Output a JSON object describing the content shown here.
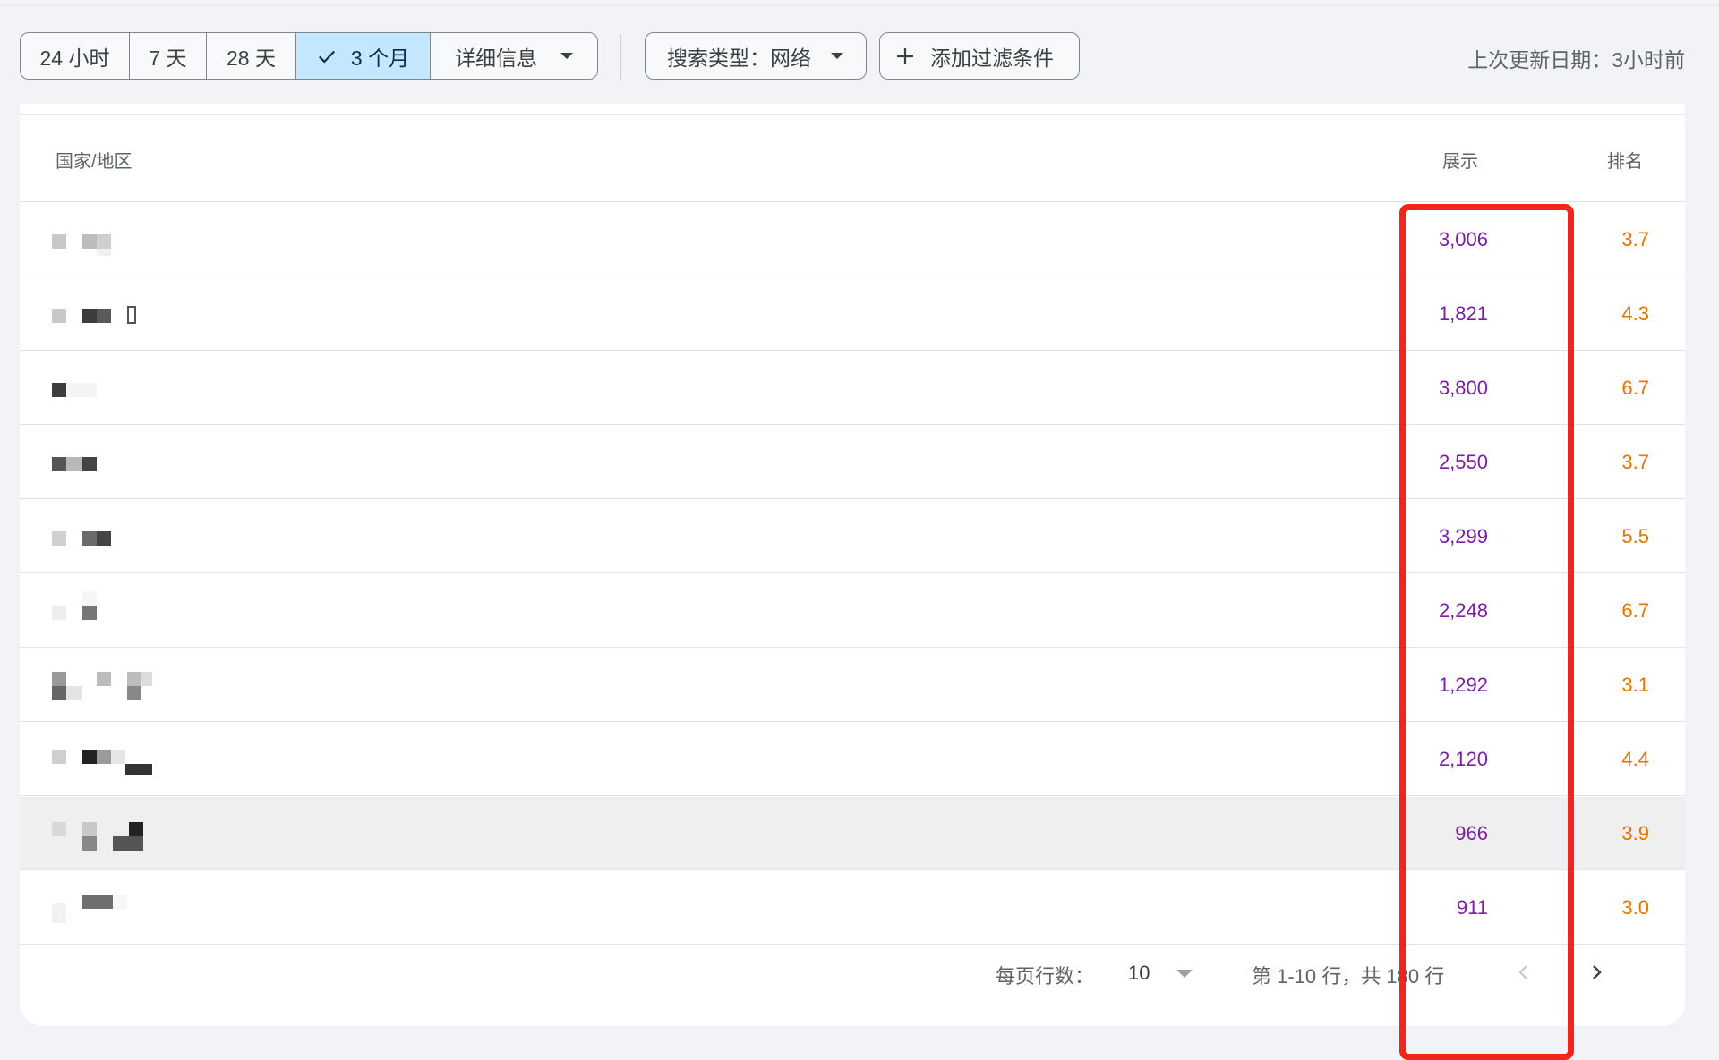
{
  "toolbar": {
    "ranges": [
      {
        "label": "24 小时",
        "active": false
      },
      {
        "label": "7 天",
        "active": false
      },
      {
        "label": "28 天",
        "active": false
      },
      {
        "label": "3 个月",
        "active": true
      }
    ],
    "more_label": "详细信息",
    "search_type_label": "搜索类型：网络",
    "add_filter_label": "添加过滤条件",
    "last_updated": "上次更新日期：3小时前"
  },
  "table": {
    "headers": {
      "country": "国家/地区",
      "impressions": "展示",
      "position": "排名"
    },
    "rows": [
      {
        "impressions": "3,006",
        "position": "3.7"
      },
      {
        "impressions": "1,821",
        "position": "4.3"
      },
      {
        "impressions": "3,800",
        "position": "6.7"
      },
      {
        "impressions": "2,550",
        "position": "3.7"
      },
      {
        "impressions": "3,299",
        "position": "5.5"
      },
      {
        "impressions": "2,248",
        "position": "6.7"
      },
      {
        "impressions": "1,292",
        "position": "3.1"
      },
      {
        "impressions": "2,120",
        "position": "4.4"
      },
      {
        "impressions": "966",
        "position": "3.9"
      },
      {
        "impressions": "911",
        "position": "3.0"
      }
    ]
  },
  "footer": {
    "rows_per_page_label": "每页行数：",
    "rows_per_page_value": "10",
    "range_text": "第 1-10 行，共 180 行"
  },
  "colors": {
    "accent_active": "#c2e7ff",
    "impressions_text": "#7b1fa2",
    "position_text": "#e37400",
    "highlight_box": "#f0261a"
  }
}
